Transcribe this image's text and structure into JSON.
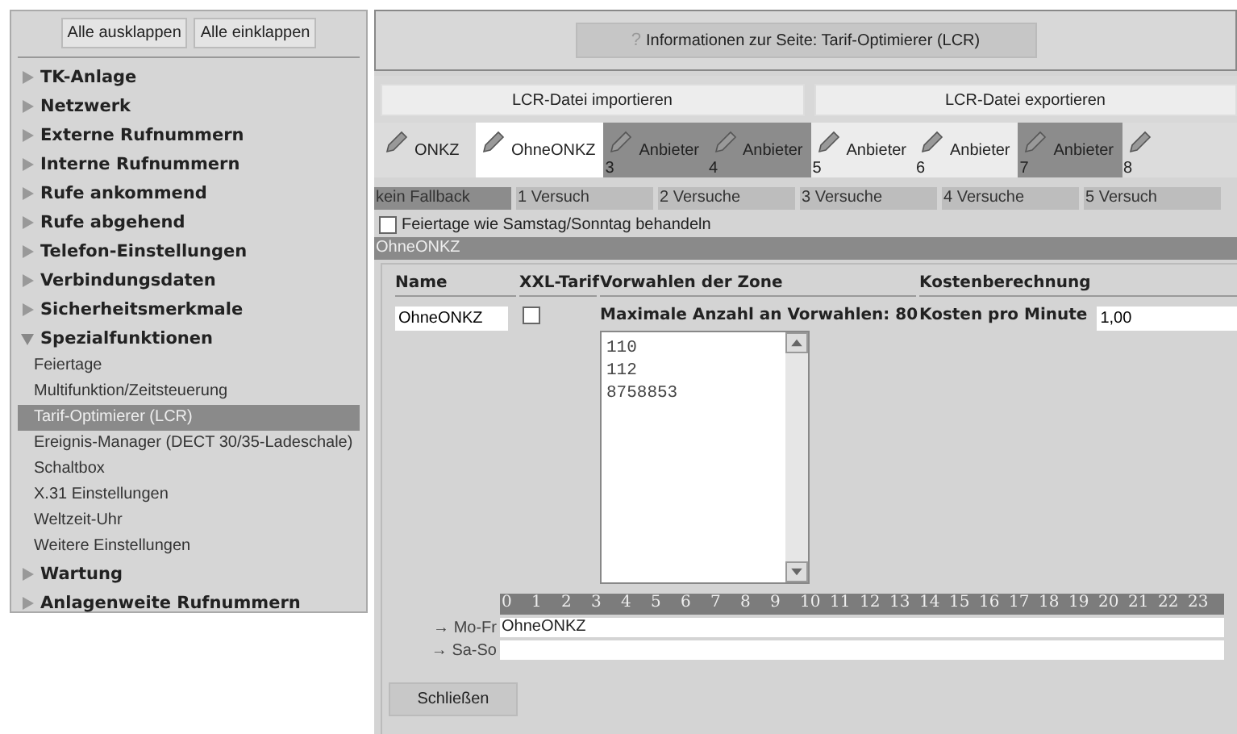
{
  "sidebar": {
    "buttons": [
      "Alle ausklappen",
      "Alle einklappen"
    ],
    "items": [
      {
        "label": "TK-Anlage",
        "expanded": false
      },
      {
        "label": "Netzwerk",
        "expanded": false
      },
      {
        "label": "Externe Rufnummern",
        "expanded": false
      },
      {
        "label": "Interne Rufnummern",
        "expanded": false
      },
      {
        "label": "Rufe ankommend",
        "expanded": false
      },
      {
        "label": "Rufe abgehend",
        "expanded": false
      },
      {
        "label": "Telefon-Einstellungen",
        "expanded": false
      },
      {
        "label": "Verbindungsdaten",
        "expanded": false
      },
      {
        "label": "Sicherheitsmerkmale",
        "expanded": false
      },
      {
        "label": "Spezialfunktionen",
        "expanded": true,
        "children": [
          {
            "label": "Feiertage",
            "selected": false
          },
          {
            "label": "Multifunktion/Zeitsteuerung",
            "selected": false
          },
          {
            "label": "Tarif-Optimierer (LCR)",
            "selected": true
          },
          {
            "label": "Ereignis-Manager (DECT 30/35-Ladeschale)",
            "selected": false
          },
          {
            "label": "Schaltbox",
            "selected": false
          },
          {
            "label": "X.31 Einstellungen",
            "selected": false
          },
          {
            "label": "Weltzeit-Uhr",
            "selected": false
          },
          {
            "label": "Weitere Einstellungen",
            "selected": false
          }
        ]
      },
      {
        "label": "Wartung",
        "expanded": false
      },
      {
        "label": "Anlagenweite Rufnummern",
        "expanded": false
      }
    ]
  },
  "info_button": {
    "icon": "?",
    "label": "Informationen zur Seite: Tarif-Optimierer (LCR)"
  },
  "file_buttons": [
    "LCR-Datei importieren",
    "LCR-Datei exportieren"
  ],
  "tabs": [
    {
      "label": "ONKZ",
      "selected": false,
      "color": "#dcdcdc"
    },
    {
      "label": "OhneONKZ",
      "selected": true
    },
    {
      "label": "Anbieter",
      "number": "3",
      "selected": false,
      "color": "#8c8c8c"
    },
    {
      "label": "Anbieter",
      "number": "4",
      "selected": false,
      "color": "#8c8c8c"
    },
    {
      "label": "Anbieter",
      "number": "5",
      "selected": false,
      "color": "#ececec"
    },
    {
      "label": "Anbieter",
      "number": "6",
      "selected": false,
      "color": "#ececec"
    },
    {
      "label": "Anbieter",
      "number": "7",
      "selected": false,
      "color": "#8c8c8c"
    },
    {
      "number": "8",
      "selected": false,
      "color": "#dcdcdc"
    }
  ],
  "fallback": [
    {
      "label": "kein Fallback",
      "selected": true
    },
    {
      "label": "1 Versuch",
      "selected": false
    },
    {
      "label": "2 Versuche",
      "selected": false
    },
    {
      "label": "3 Versuche",
      "selected": false
    },
    {
      "label": "4 Versuche",
      "selected": false
    },
    {
      "label": "5 Versuch",
      "selected": false
    }
  ],
  "holiday_option": {
    "label": "Feiertage wie Samstag/Sonntag behandeln",
    "checked": false
  },
  "section_title": "OhneONKZ",
  "form": {
    "columns": [
      "Name",
      "XXL-Tarif",
      "Vorwahlen der Zone",
      "Kostenberechnung"
    ],
    "name_value": "OhneONKZ",
    "xxl_checked": false,
    "max_label": "Maximale Anzahl an Vorwahlen: 80",
    "prefixes": [
      "110",
      "112",
      "8758853"
    ],
    "cost_label": "Kosten pro Minute",
    "cost_value": "1,00"
  },
  "schedule": {
    "hours": [
      "0",
      "1",
      "2",
      "3",
      "4",
      "5",
      "6",
      "7",
      "8",
      "9",
      "10",
      "11",
      "12",
      "13",
      "14",
      "15",
      "16",
      "17",
      "18",
      "19",
      "20",
      "21",
      "22",
      "23"
    ],
    "rows": [
      {
        "arrow": "→",
        "label": "Mo-Fr",
        "value": "OhneONKZ"
      },
      {
        "arrow": "→",
        "label": "Sa-So"
      }
    ]
  },
  "close_button": "Schließen"
}
